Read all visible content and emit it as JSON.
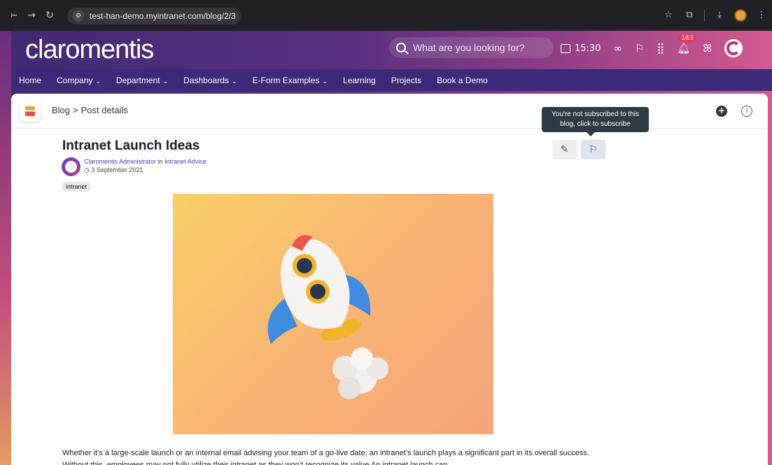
{
  "browser": {
    "url": "test-han-demo.myintranet.com/blog/2/3",
    "icons": [
      "back-icon",
      "forward-icon",
      "reload-icon",
      "site-info-icon",
      "star-icon",
      "extensions-icon",
      "download-icon",
      "profile-icon",
      "more-icon"
    ]
  },
  "app": {
    "logo": "claromentis",
    "search_placeholder": "What are you looking for?",
    "time": "15:30",
    "notifications_count": "163",
    "menu": [
      {
        "label": "Home",
        "dropdown": false
      },
      {
        "label": "Company",
        "dropdown": true
      },
      {
        "label": "Department",
        "dropdown": true
      },
      {
        "label": "Dashboards",
        "dropdown": true
      },
      {
        "label": "E-Form Examples",
        "dropdown": true
      },
      {
        "label": "Learning",
        "dropdown": false
      },
      {
        "label": "Projects",
        "dropdown": false
      },
      {
        "label": "Book a Demo",
        "dropdown": false
      }
    ]
  },
  "page": {
    "breadcrumb_root": "Blog",
    "breadcrumb_sep": ">",
    "breadcrumb_current": "Post details",
    "tooltip_line1": "You're not subscribed to this",
    "tooltip_line2": "blog, click to subscribe"
  },
  "post": {
    "title": "Intranet Launch Ideas",
    "author": "Claromentis Administrator",
    "in_word": "in",
    "category": "Intranet Advice",
    "date": "3 September 2021",
    "tag": "intranet",
    "body": "Whether it’s a large-scale launch or an internal email advising your team of a go-live date; an intranet’s launch plays a significant part in its overall success. Without this, employees may not fully utilize their intranet as they won’t recognize its value An intranet launch can"
  },
  "colors": {
    "menubar": "#3b2a78",
    "accent_link": "#4a3aa8",
    "badge": "#e53957"
  }
}
